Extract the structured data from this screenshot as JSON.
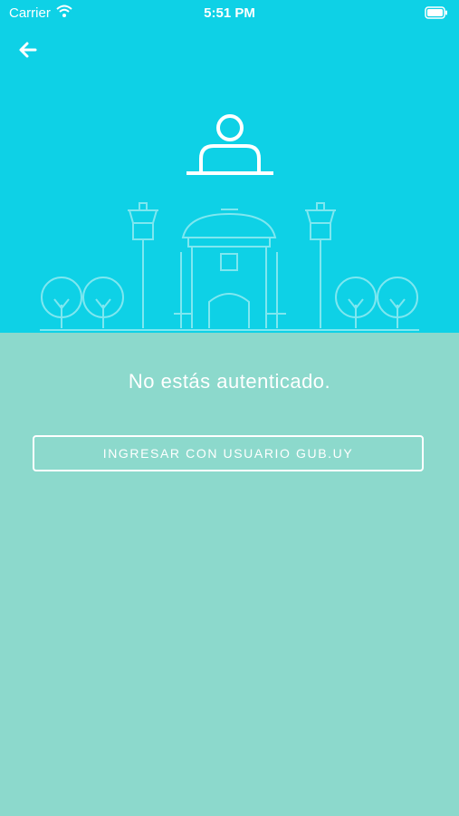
{
  "status_bar": {
    "carrier": "Carrier",
    "time": "5:51 PM"
  },
  "icons": {
    "back": "back-arrow-icon",
    "wifi": "wifi-icon",
    "battery": "battery-icon",
    "user": "user-desk-icon"
  },
  "auth": {
    "message": "No estás autenticado.",
    "login_button": "INGRESAR CON USUARIO GUB.UY"
  },
  "colors": {
    "top_background": "#0ed1e6",
    "bottom_background": "#8cd9cc",
    "foreground": "#ffffff"
  }
}
